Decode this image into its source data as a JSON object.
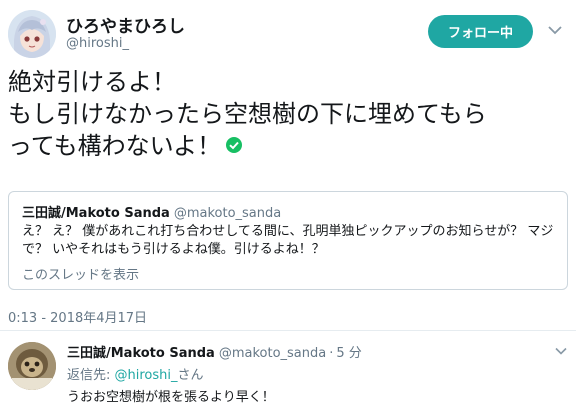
{
  "author": {
    "display_name": "ひろやまひろし",
    "handle": "@hiroshi_"
  },
  "follow_button": {
    "label": "フォロー中"
  },
  "tweet": {
    "lines": [
      "絶対引けるよ！",
      "もし引けなかったら空想樹の下に埋めてもら",
      "っても構わないよ！"
    ]
  },
  "quote": {
    "name": "三田誠/Makoto Sanda",
    "handle": "@makoto_sanda",
    "text": "え？ え？ 僕があれこれ打ち合わせしてる間に、孔明単独ピックアップのお知らせが？ マジで？ いやそれはもう引けるよね僕。引けるよね！？",
    "thread_link": "このスレッドを表示"
  },
  "timestamp": "0:13 - 2018年4月17日",
  "reply": {
    "name": "三田誠/Makoto Sanda",
    "handle": "@makoto_sanda",
    "separator": "·",
    "time": "5 分",
    "replying_to_prefix": "返信先: ",
    "replying_to_handle": "@hiroshi_",
    "replying_to_suffix": "さん",
    "text": "うおお空想樹が根を張るより早く！"
  },
  "colors": {
    "accent": "#1fa7a3",
    "text": "#14171a",
    "muted": "#657786",
    "border": "#ccd6dd",
    "check": "#17bf63"
  },
  "icons": {
    "verified": "check-circle-icon",
    "menu": "chevron-down-icon"
  }
}
